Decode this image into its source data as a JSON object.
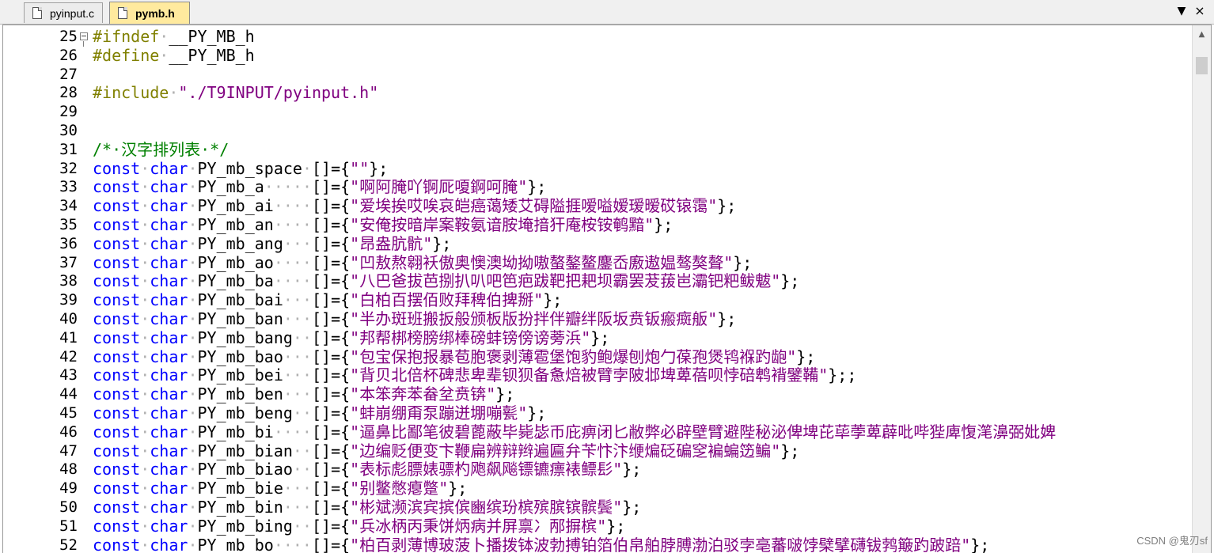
{
  "tabs": [
    {
      "label": "pyinput.c",
      "active": false
    },
    {
      "label": "pymb.h",
      "active": true
    }
  ],
  "tab_controls": {
    "dropdown": "▼",
    "close": "×"
  },
  "code_lines": [
    {
      "num": "25",
      "fold": true,
      "segs": [
        [
          "pp",
          "#ifndef"
        ],
        [
          "dot",
          "·"
        ],
        [
          "id",
          "__PY_MB_h"
        ]
      ]
    },
    {
      "num": "26",
      "segs": [
        [
          "pp",
          "#define"
        ],
        [
          "dot",
          "·"
        ],
        [
          "id",
          "__PY_MB_h"
        ]
      ]
    },
    {
      "num": "27",
      "segs": []
    },
    {
      "num": "28",
      "segs": [
        [
          "pp",
          "#include"
        ],
        [
          "dot",
          "·"
        ],
        [
          "st",
          "\"./T9INPUT/pyinput.h\""
        ]
      ]
    },
    {
      "num": "29",
      "segs": []
    },
    {
      "num": "30",
      "segs": []
    },
    {
      "num": "31",
      "segs": [
        [
          "cm",
          "/*·汉字排列表·*/"
        ]
      ]
    },
    {
      "num": "32",
      "segs": [
        [
          "kw",
          "const"
        ],
        [
          "dot",
          "·"
        ],
        [
          "kw",
          "char"
        ],
        [
          "dot",
          "·"
        ],
        [
          "id",
          "PY_mb_space"
        ],
        [
          "dot",
          "·"
        ],
        [
          "id",
          "[]={"
        ],
        [
          "st",
          "\"\""
        ],
        [
          "id",
          "};"
        ]
      ]
    },
    {
      "num": "33",
      "segs": [
        [
          "kw",
          "const"
        ],
        [
          "dot",
          "·"
        ],
        [
          "kw",
          "char"
        ],
        [
          "dot",
          "·"
        ],
        [
          "id",
          "PY_mb_a"
        ],
        [
          "dot",
          "·····"
        ],
        [
          "id",
          "[]={"
        ],
        [
          "st",
          "\"啊阿腌吖锕厑嗄錒呵腌\""
        ],
        [
          "id",
          "};"
        ]
      ]
    },
    {
      "num": "34",
      "segs": [
        [
          "kw",
          "const"
        ],
        [
          "dot",
          "·"
        ],
        [
          "kw",
          "char"
        ],
        [
          "dot",
          "·"
        ],
        [
          "id",
          "PY_mb_ai"
        ],
        [
          "dot",
          "····"
        ],
        [
          "id",
          "[]={"
        ],
        [
          "st",
          "\"爱埃挨哎唉哀皑癌蔼矮艾碍隘捱嗳嗌嫒瑷暧砹锿霭\""
        ],
        [
          "id",
          "};"
        ]
      ]
    },
    {
      "num": "35",
      "segs": [
        [
          "kw",
          "const"
        ],
        [
          "dot",
          "·"
        ],
        [
          "kw",
          "char"
        ],
        [
          "dot",
          "·"
        ],
        [
          "id",
          "PY_mb_an"
        ],
        [
          "dot",
          "····"
        ],
        [
          "id",
          "[]={"
        ],
        [
          "st",
          "\"安俺按暗岸案鞍氨谙胺埯揞犴庵桉铵鹌黯\""
        ],
        [
          "id",
          "};"
        ]
      ]
    },
    {
      "num": "36",
      "segs": [
        [
          "kw",
          "const"
        ],
        [
          "dot",
          "·"
        ],
        [
          "kw",
          "char"
        ],
        [
          "dot",
          "·"
        ],
        [
          "id",
          "PY_mb_ang"
        ],
        [
          "dot",
          "···"
        ],
        [
          "id",
          "[]={"
        ],
        [
          "st",
          "\"昂盎肮骯\""
        ],
        [
          "id",
          "};"
        ]
      ]
    },
    {
      "num": "37",
      "segs": [
        [
          "kw",
          "const"
        ],
        [
          "dot",
          "·"
        ],
        [
          "kw",
          "char"
        ],
        [
          "dot",
          "·"
        ],
        [
          "id",
          "PY_mb_ao"
        ],
        [
          "dot",
          "····"
        ],
        [
          "id",
          "[]={"
        ],
        [
          "st",
          "\"凹敖熬翱袄傲奥懊澳坳拗嗷螯鏊鳌鏖岙廒遨媪骜獒聱\""
        ],
        [
          "id",
          "};"
        ]
      ]
    },
    {
      "num": "38",
      "segs": [
        [
          "kw",
          "const"
        ],
        [
          "dot",
          "·"
        ],
        [
          "kw",
          "char"
        ],
        [
          "dot",
          "·"
        ],
        [
          "id",
          "PY_mb_ba"
        ],
        [
          "dot",
          "····"
        ],
        [
          "id",
          "[]={"
        ],
        [
          "st",
          "\"八巴爸拔芭捌扒叭吧笆疤跋靶把耙坝霸罢茇菝岜灞钯粑鲅魃\""
        ],
        [
          "id",
          "};"
        ]
      ]
    },
    {
      "num": "39",
      "segs": [
        [
          "kw",
          "const"
        ],
        [
          "dot",
          "·"
        ],
        [
          "kw",
          "char"
        ],
        [
          "dot",
          "·"
        ],
        [
          "id",
          "PY_mb_bai"
        ],
        [
          "dot",
          "···"
        ],
        [
          "id",
          "[]={"
        ],
        [
          "st",
          "\"白柏百摆佰败拜稗伯捭掰\""
        ],
        [
          "id",
          "};"
        ]
      ]
    },
    {
      "num": "40",
      "segs": [
        [
          "kw",
          "const"
        ],
        [
          "dot",
          "·"
        ],
        [
          "kw",
          "char"
        ],
        [
          "dot",
          "·"
        ],
        [
          "id",
          "PY_mb_ban"
        ],
        [
          "dot",
          "···"
        ],
        [
          "id",
          "[]={"
        ],
        [
          "st",
          "\"半办斑班搬扳般颁板版扮拌伴瓣绊阪坂贲钣瘢癍舨\""
        ],
        [
          "id",
          "};"
        ]
      ]
    },
    {
      "num": "41",
      "segs": [
        [
          "kw",
          "const"
        ],
        [
          "dot",
          "·"
        ],
        [
          "kw",
          "char"
        ],
        [
          "dot",
          "·"
        ],
        [
          "id",
          "PY_mb_bang"
        ],
        [
          "dot",
          "··"
        ],
        [
          "id",
          "[]={"
        ],
        [
          "st",
          "\"邦帮梆榜膀绑棒磅蚌镑傍谤蒡浜\""
        ],
        [
          "id",
          "};"
        ]
      ]
    },
    {
      "num": "42",
      "segs": [
        [
          "kw",
          "const"
        ],
        [
          "dot",
          "·"
        ],
        [
          "kw",
          "char"
        ],
        [
          "dot",
          "·"
        ],
        [
          "id",
          "PY_mb_bao"
        ],
        [
          "dot",
          "···"
        ],
        [
          "id",
          "[]={"
        ],
        [
          "st",
          "\"包宝保抱报暴苞胞褒剥薄雹堡饱豹鲍爆刨炮勹葆孢煲鸨褓趵龅\""
        ],
        [
          "id",
          "};"
        ]
      ]
    },
    {
      "num": "43",
      "segs": [
        [
          "kw",
          "const"
        ],
        [
          "dot",
          "·"
        ],
        [
          "kw",
          "char"
        ],
        [
          "dot",
          "·"
        ],
        [
          "id",
          "PY_mb_bei"
        ],
        [
          "dot",
          "···"
        ],
        [
          "id",
          "[]={"
        ],
        [
          "st",
          "\"背贝北倍杯碑悲卑辈钡狈备惫焙被臂孛陂邶埤萆蓓呗悖碚鹎褙鐾鞴\""
        ],
        [
          "id",
          "};;"
        ]
      ]
    },
    {
      "num": "44",
      "segs": [
        [
          "kw",
          "const"
        ],
        [
          "dot",
          "·"
        ],
        [
          "kw",
          "char"
        ],
        [
          "dot",
          "·"
        ],
        [
          "id",
          "PY_mb_ben"
        ],
        [
          "dot",
          "···"
        ],
        [
          "id",
          "[]={"
        ],
        [
          "st",
          "\"本笨奔苯畚坌贲锛\""
        ],
        [
          "id",
          "};"
        ]
      ]
    },
    {
      "num": "45",
      "segs": [
        [
          "kw",
          "const"
        ],
        [
          "dot",
          "·"
        ],
        [
          "kw",
          "char"
        ],
        [
          "dot",
          "·"
        ],
        [
          "id",
          "PY_mb_beng"
        ],
        [
          "dot",
          "··"
        ],
        [
          "id",
          "[]={"
        ],
        [
          "st",
          "\"蚌崩绷甭泵蹦迸堋嘣甏\""
        ],
        [
          "id",
          "};"
        ]
      ]
    },
    {
      "num": "46",
      "segs": [
        [
          "kw",
          "const"
        ],
        [
          "dot",
          "·"
        ],
        [
          "kw",
          "char"
        ],
        [
          "dot",
          "·"
        ],
        [
          "id",
          "PY_mb_bi"
        ],
        [
          "dot",
          "····"
        ],
        [
          "id",
          "[]={"
        ],
        [
          "st",
          "\"逼鼻比鄙笔彼碧蓖蔽毕毙毖币庇痹闭匕敝弊必辟壁臂避陛秘泌俾埤芘荜荸萆薜吡哔狴庳愎滗濞弼妣婢"
        ]
      ]
    },
    {
      "num": "47",
      "segs": [
        [
          "kw",
          "const"
        ],
        [
          "dot",
          "·"
        ],
        [
          "kw",
          "char"
        ],
        [
          "dot",
          "·"
        ],
        [
          "id",
          "PY_mb_bian"
        ],
        [
          "dot",
          "··"
        ],
        [
          "id",
          "[]={"
        ],
        [
          "st",
          "\"边编贬便变卞鞭扁辨辩辫遍匾弁苄忭汴缏煸砭碥窆褊蝙笾鳊\""
        ],
        [
          "id",
          "};"
        ]
      ]
    },
    {
      "num": "48",
      "segs": [
        [
          "kw",
          "const"
        ],
        [
          "dot",
          "·"
        ],
        [
          "kw",
          "char"
        ],
        [
          "dot",
          "·"
        ],
        [
          "id",
          "PY_mb_biao"
        ],
        [
          "dot",
          "··"
        ],
        [
          "id",
          "[]={"
        ],
        [
          "st",
          "\"表标彪膘婊骠杓飑飙飚镖镳瘭裱鳔髟\""
        ],
        [
          "id",
          "};"
        ]
      ]
    },
    {
      "num": "49",
      "segs": [
        [
          "kw",
          "const"
        ],
        [
          "dot",
          "·"
        ],
        [
          "kw",
          "char"
        ],
        [
          "dot",
          "·"
        ],
        [
          "id",
          "PY_mb_bie"
        ],
        [
          "dot",
          "···"
        ],
        [
          "id",
          "[]={"
        ],
        [
          "st",
          "\"别鳖憋瘪蹩\""
        ],
        [
          "id",
          "};"
        ]
      ]
    },
    {
      "num": "50",
      "segs": [
        [
          "kw",
          "const"
        ],
        [
          "dot",
          "·"
        ],
        [
          "kw",
          "char"
        ],
        [
          "dot",
          "·"
        ],
        [
          "id",
          "PY_mb_bin"
        ],
        [
          "dot",
          "···"
        ],
        [
          "id",
          "[]={"
        ],
        [
          "st",
          "\"彬斌濒滨宾摈傧豳缤玢槟殡膑镔髌鬓\""
        ],
        [
          "id",
          "};"
        ]
      ]
    },
    {
      "num": "51",
      "segs": [
        [
          "kw",
          "const"
        ],
        [
          "dot",
          "·"
        ],
        [
          "kw",
          "char"
        ],
        [
          "dot",
          "·"
        ],
        [
          "id",
          "PY_mb_bing"
        ],
        [
          "dot",
          "··"
        ],
        [
          "id",
          "[]={"
        ],
        [
          "st",
          "\"兵冰柄丙秉饼炳病并屏禀冫邴摒槟\""
        ],
        [
          "id",
          "};"
        ]
      ]
    },
    {
      "num": "52",
      "segs": [
        [
          "kw",
          "const"
        ],
        [
          "dot",
          "·"
        ],
        [
          "kw",
          "char"
        ],
        [
          "dot",
          "·"
        ],
        [
          "id",
          "PY_mb_bo"
        ],
        [
          "dot",
          "····"
        ],
        [
          "id",
          "[]={"
        ],
        [
          "st",
          "\"柏百剥薄博玻菠卜播拨钵波勃搏铂箔伯帛舶脖膊渤泊驳孛亳蕃啵饽檗擘礴钹鹁簸趵跛踣\""
        ],
        [
          "id",
          "};"
        ]
      ]
    }
  ],
  "watermark": "CSDN @鬼刃sf",
  "colors": {
    "preprocessor": "#808000",
    "keyword": "#0000ff",
    "comment": "#008000",
    "string": "#800080",
    "active_tab": "#ffea9e"
  }
}
